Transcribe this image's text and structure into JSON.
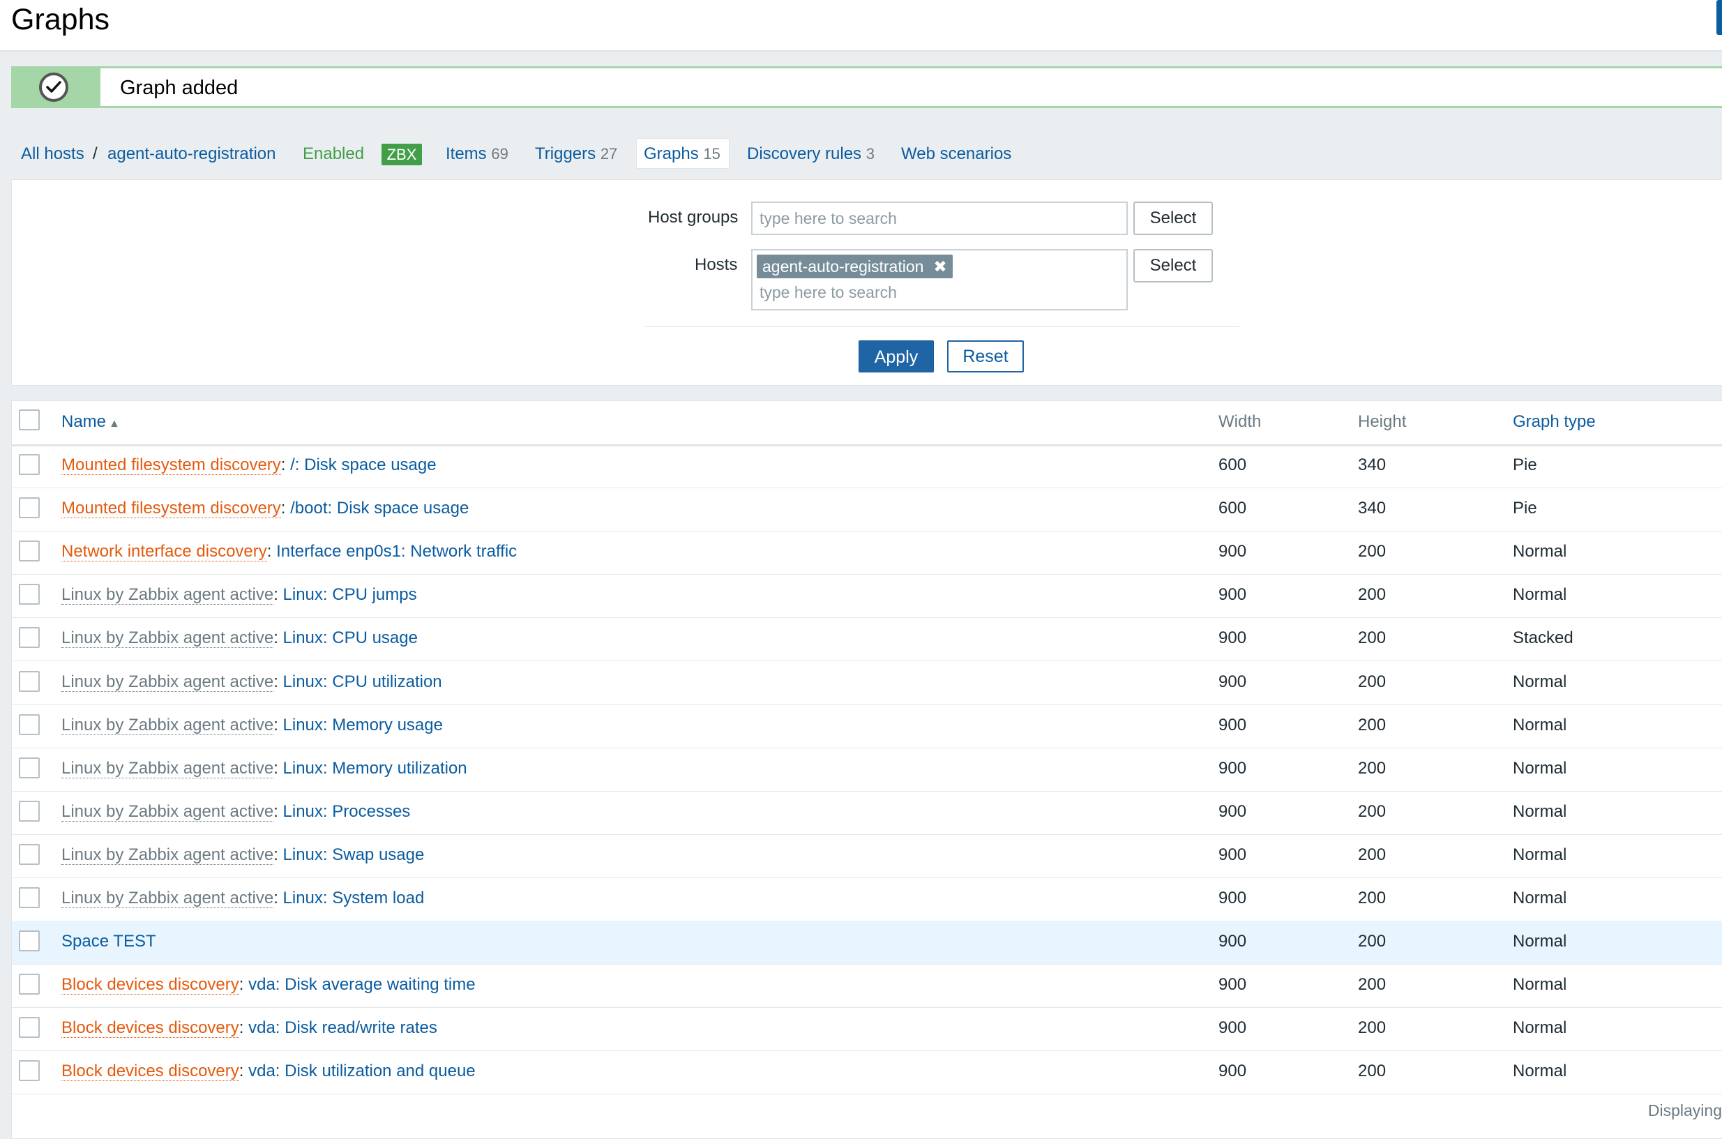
{
  "header": {
    "title": "Graphs"
  },
  "message": {
    "text": "Graph added",
    "icon": "check-circle-icon",
    "color": "#a5d6a7"
  },
  "nav": {
    "all_hosts": "All hosts",
    "separator": "/",
    "host": "agent-auto-registration",
    "enabled": "Enabled",
    "zbx": "ZBX",
    "items": {
      "label": "Items",
      "count": "69"
    },
    "triggers": {
      "label": "Triggers",
      "count": "27"
    },
    "graphs": {
      "label": "Graphs",
      "count": "15"
    },
    "discovery": {
      "label": "Discovery rules",
      "count": "3"
    },
    "web": {
      "label": "Web scenarios"
    }
  },
  "filter": {
    "host_groups_label": "Host groups",
    "host_groups_placeholder": "type here to search",
    "hosts_label": "Hosts",
    "hosts_chip": "agent-auto-registration",
    "hosts_chip_remove": "✖",
    "hosts_placeholder": "type here to search",
    "select_label": "Select",
    "apply_label": "Apply",
    "reset_label": "Reset"
  },
  "table": {
    "columns": {
      "name": "Name",
      "sort_indicator": "▲",
      "width": "Width",
      "height": "Height",
      "graph_type": "Graph type"
    },
    "rows": [
      {
        "prefix": "Mounted filesystem discovery",
        "prefix_type": "orange",
        "sep": ": ",
        "name": "/: Disk space usage",
        "width": "600",
        "height": "340",
        "type": "Pie"
      },
      {
        "prefix": "Mounted filesystem discovery",
        "prefix_type": "orange",
        "sep": ": ",
        "name": "/boot: Disk space usage",
        "width": "600",
        "height": "340",
        "type": "Pie"
      },
      {
        "prefix": "Network interface discovery",
        "prefix_type": "orange",
        "sep": ": ",
        "name": "Interface enp0s1: Network traffic",
        "width": "900",
        "height": "200",
        "type": "Normal"
      },
      {
        "prefix": "Linux by Zabbix agent active",
        "prefix_type": "gray",
        "sep": ": ",
        "name": "Linux: CPU jumps",
        "width": "900",
        "height": "200",
        "type": "Normal"
      },
      {
        "prefix": "Linux by Zabbix agent active",
        "prefix_type": "gray",
        "sep": ": ",
        "name": "Linux: CPU usage",
        "width": "900",
        "height": "200",
        "type": "Stacked"
      },
      {
        "prefix": "Linux by Zabbix agent active",
        "prefix_type": "gray",
        "sep": ": ",
        "name": "Linux: CPU utilization",
        "width": "900",
        "height": "200",
        "type": "Normal"
      },
      {
        "prefix": "Linux by Zabbix agent active",
        "prefix_type": "gray",
        "sep": ": ",
        "name": "Linux: Memory usage",
        "width": "900",
        "height": "200",
        "type": "Normal"
      },
      {
        "prefix": "Linux by Zabbix agent active",
        "prefix_type": "gray",
        "sep": ": ",
        "name": "Linux: Memory utilization",
        "width": "900",
        "height": "200",
        "type": "Normal"
      },
      {
        "prefix": "Linux by Zabbix agent active",
        "prefix_type": "gray",
        "sep": ": ",
        "name": "Linux: Processes",
        "width": "900",
        "height": "200",
        "type": "Normal"
      },
      {
        "prefix": "Linux by Zabbix agent active",
        "prefix_type": "gray",
        "sep": ": ",
        "name": "Linux: Swap usage",
        "width": "900",
        "height": "200",
        "type": "Normal"
      },
      {
        "prefix": "Linux by Zabbix agent active",
        "prefix_type": "gray",
        "sep": ": ",
        "name": "Linux: System load",
        "width": "900",
        "height": "200",
        "type": "Normal"
      },
      {
        "prefix": "",
        "prefix_type": "none",
        "sep": "",
        "name": "Space TEST",
        "width": "900",
        "height": "200",
        "type": "Normal",
        "highlighted": true
      },
      {
        "prefix": "Block devices discovery",
        "prefix_type": "orange",
        "sep": ": ",
        "name": "vda: Disk average waiting time",
        "width": "900",
        "height": "200",
        "type": "Normal"
      },
      {
        "prefix": "Block devices discovery",
        "prefix_type": "orange",
        "sep": ": ",
        "name": "vda: Disk read/write rates",
        "width": "900",
        "height": "200",
        "type": "Normal"
      },
      {
        "prefix": "Block devices discovery",
        "prefix_type": "orange",
        "sep": ": ",
        "name": "vda: Disk utilization and queue",
        "width": "900",
        "height": "200",
        "type": "Normal"
      }
    ]
  },
  "footer": {
    "text": "Displaying"
  }
}
